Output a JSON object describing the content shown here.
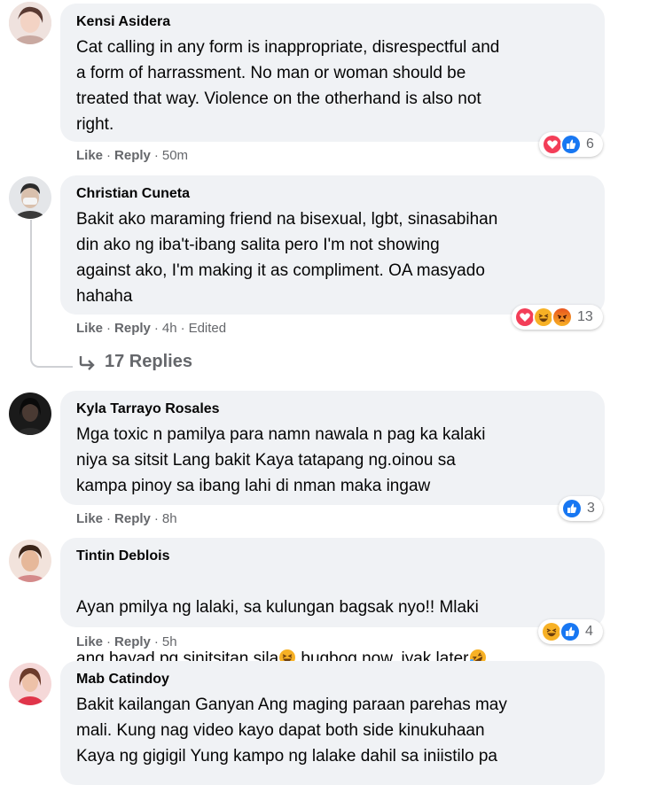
{
  "actions": {
    "like": "Like",
    "reply": "Reply",
    "separator": "·"
  },
  "colors": {
    "bubble": "#f0f2f5",
    "meta": "#65676b",
    "love": "#f33e58",
    "like": "#1877f2",
    "haha": "#f7b125"
  },
  "comments": [
    {
      "author": "Kensi Asidera",
      "text": "Cat calling in any form is inappropriate, disrespectful and\na form of harrassment. No man or woman should be\ntreated that way. Violence on the otherhand is also not\nright.",
      "time": "50m",
      "edited": "",
      "reactions": [
        "love",
        "like"
      ],
      "reaction_count": "6"
    },
    {
      "author": "Christian Cuneta",
      "text": "Bakit ako maraming friend na bisexual, lgbt, sinasabihan\ndin ako ng iba't-ibang salita pero I'm not showing\nagainst ako, I'm making it as compliment. OA masyado\nhahaha",
      "time": "4h",
      "edited": "Edited",
      "reactions": [
        "love",
        "haha",
        "angry"
      ],
      "reaction_count": "13"
    },
    {
      "author": "Kyla Tarrayo Rosales",
      "text": "Mga toxic n pamilya para namn nawala n pag ka kalaki\nniya sa sitsit Lang bakit Kaya tatapang ng.oinou sa\nkampa pinoy sa ibang lahi di nman maka ingaw",
      "time": "8h",
      "edited": "",
      "reactions": [
        "like"
      ],
      "reaction_count": "3"
    },
    {
      "author": "Tintin Deblois",
      "text_line1": "Ayan pmilya ng lalaki, sa kulungan bagsak nyo!! Mlaki",
      "text_line2a": "ang bayad pg sinitsitan sila",
      "text_line2b": " bugbog now, iyak later",
      "time": "5h",
      "edited": "",
      "reactions": [
        "haha",
        "like"
      ],
      "reaction_count": "4"
    },
    {
      "author": "Mab Catindoy",
      "text": "Bakit kailangan Ganyan Ang maging paraan parehas may\nmali. Kung nag video kayo dapat both side kinukuhaan\nKaya ng gigigil Yung kampo ng lalake dahil sa iniistilo pa"
    }
  ],
  "replies_label": "17 Replies"
}
